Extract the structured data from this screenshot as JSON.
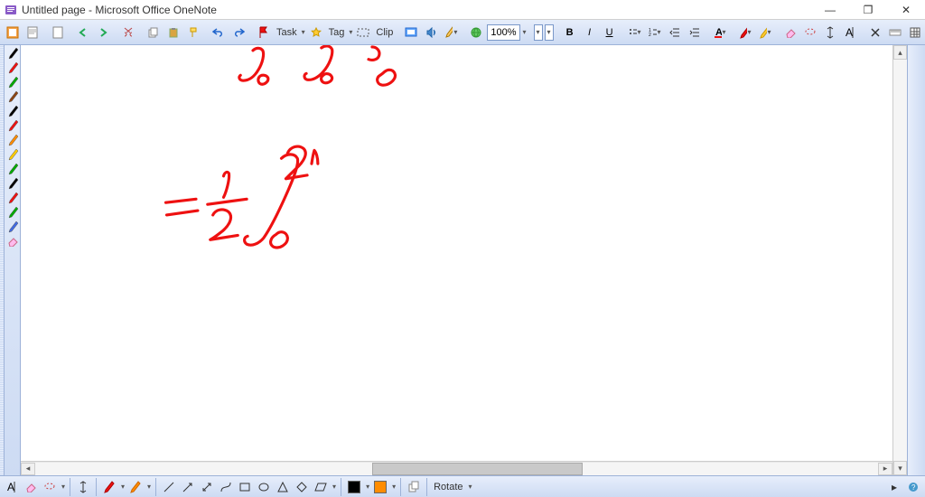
{
  "window": {
    "title": "Untitled page - Microsoft Office OneNote",
    "minimize": "—",
    "maximize": "❐",
    "close": "✕"
  },
  "toolbar": {
    "task_label": "Task",
    "tag_label": "Tag",
    "clip_label": "Clip",
    "zoom_value": "100%",
    "font_combo": "",
    "size_combo": "",
    "bold": "B",
    "italic": "I",
    "underline": "U"
  },
  "pens": [
    {
      "color": "#000000"
    },
    {
      "color": "#e11"
    },
    {
      "color": "#0a0"
    },
    {
      "color": "#8b4513"
    },
    {
      "color": "#000000"
    },
    {
      "color": "#e11"
    },
    {
      "color": "#ff8c00"
    },
    {
      "color": "#ffcc00"
    },
    {
      "color": "#0a0"
    },
    {
      "color": "#000000"
    },
    {
      "color": "#e11"
    },
    {
      "color": "#0a0"
    },
    {
      "color": "#4169e1"
    }
  ],
  "bottom": {
    "rotate_label": "Rotate",
    "line_color": "#000000",
    "fill_color": "#ff8c00",
    "pen_color": "#e11",
    "pen2_color": "#ff8c00"
  },
  "ink": {
    "description": "Red handwritten mathematical notation showing partial integral expressions",
    "color": "#e11"
  }
}
